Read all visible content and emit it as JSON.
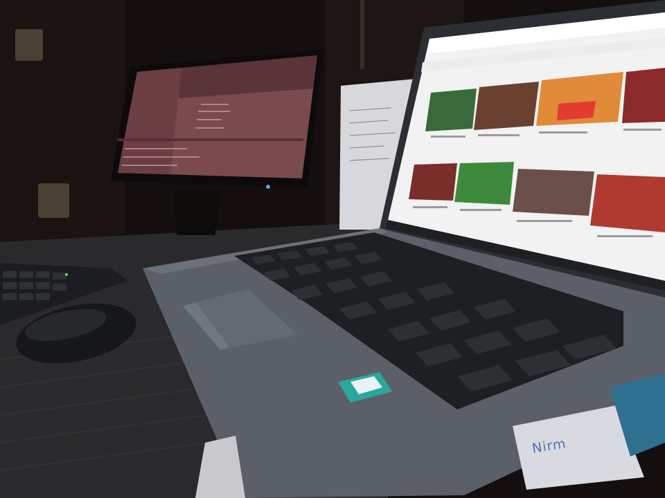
{
  "scene": {
    "description_free": true,
    "notebook_logo_text": "Nirm"
  },
  "colors": {
    "background": "#120d0c",
    "monitor_screen": "#7a4a4e",
    "laptop_body": "#5b6068",
    "keyboard_keys": "#1d1f23",
    "youtube_bg": "#f2f2f2",
    "youtube_red": "#e23b30",
    "sticker": "#2aa8a0"
  },
  "icons": {
    "mouse": "mouse-icon",
    "keyboard": "keyboard-icon",
    "laptop": "laptop-icon",
    "monitor": "monitor-icon"
  }
}
